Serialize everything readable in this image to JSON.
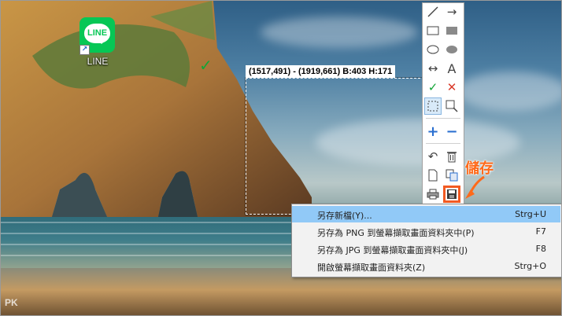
{
  "desktop": {
    "shortcut_label": "LINE",
    "line_logo_text": "LINE"
  },
  "selection": {
    "coords_text": "(1517,491) - (1919,661)  B:403 H:171"
  },
  "toolbar": {
    "tools": [
      "line-tool",
      "arrow-tool",
      "rectangle-tool",
      "filled-rectangle-tool",
      "ellipse-tool",
      "filled-ellipse-tool",
      "double-arrow-tool",
      "text-tool",
      "confirm-tool",
      "cancel-tool",
      "select-tool",
      "zoom-tool",
      "zoom-in-tool",
      "zoom-out-tool",
      "undo-tool",
      "delete-tool",
      "new-tool",
      "copy-tool",
      "print-tool",
      "save-tool"
    ],
    "text_tool_glyph": "A"
  },
  "annotation": {
    "callout": "儲存",
    "color": "#ff6a1a"
  },
  "context_menu": {
    "items": [
      {
        "label": "另存新檔(Y)...",
        "shortcut": "Strg+U"
      },
      {
        "label": "另存為 PNG 到螢幕擷取畫面資料夾中(P)",
        "shortcut": "F7"
      },
      {
        "label": "另存為 JPG 到螢幕擷取畫面資料夾中(J)",
        "shortcut": "F8"
      },
      {
        "label": "開啟螢幕擷取畫面資料夾(Z)",
        "shortcut": "Strg+O"
      }
    ],
    "highlight_color": "#91c9f7"
  },
  "watermark": {
    "text": "PK"
  }
}
